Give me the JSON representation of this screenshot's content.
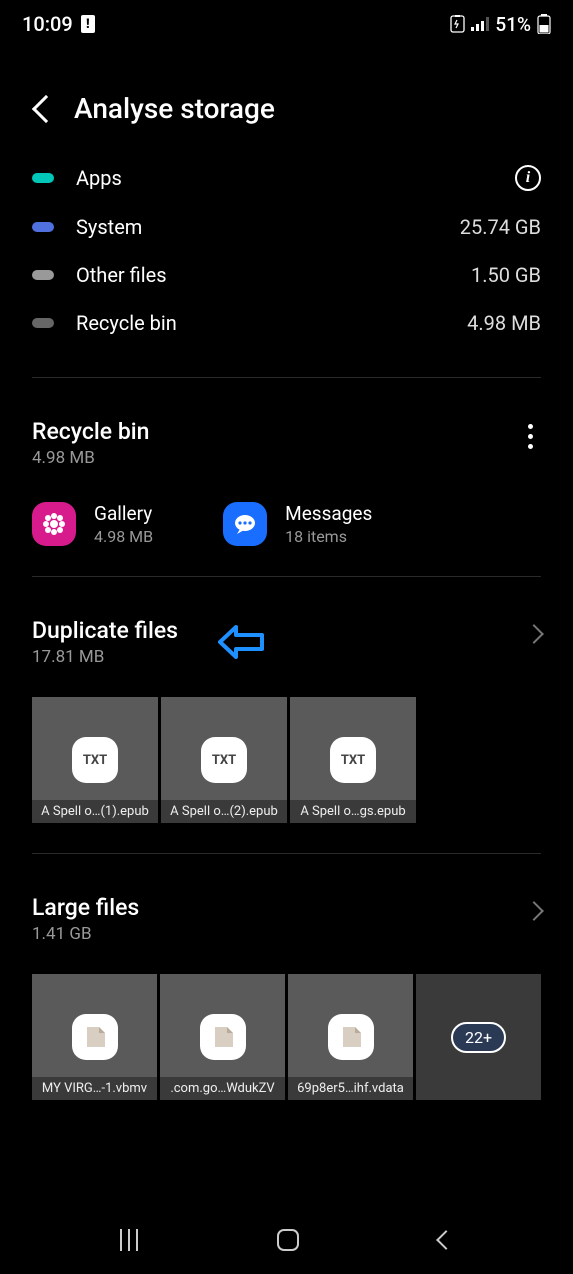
{
  "status": {
    "time": "10:09",
    "battery_text": "51%"
  },
  "header": {
    "title": "Analyse storage"
  },
  "categories": [
    {
      "label": "Apps",
      "value": ""
    },
    {
      "label": "System",
      "value": "25.74 GB"
    },
    {
      "label": "Other files",
      "value": "1.50 GB"
    },
    {
      "label": "Recycle bin",
      "value": "4.98 MB"
    }
  ],
  "recycle": {
    "title": "Recycle bin",
    "size": "4.98 MB",
    "items": [
      {
        "name": "Gallery",
        "detail": "4.98 MB"
      },
      {
        "name": "Messages",
        "detail": "18 items"
      }
    ]
  },
  "duplicates": {
    "title": "Duplicate files",
    "size": "17.81 MB",
    "icon_label": "TXT",
    "files": [
      "A Spell o…(1).epub",
      "A Spell o…(2).epub",
      "A Spell o…gs.epub"
    ]
  },
  "large": {
    "title": "Large files",
    "size": "1.41 GB",
    "more_label": "22+",
    "files": [
      "MY VIRG…-1.vbmv",
      ".com.go…WdukZV",
      "69p8er5…ihf.vdata"
    ]
  }
}
